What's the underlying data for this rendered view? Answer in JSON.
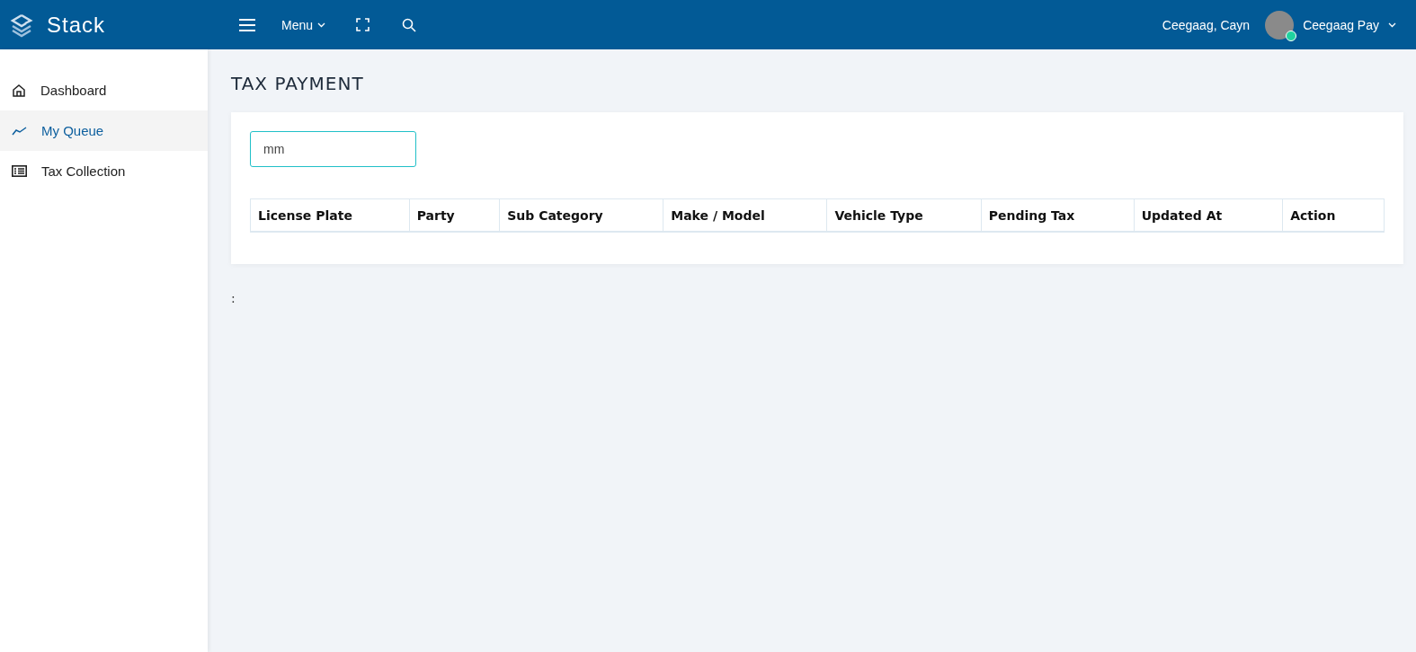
{
  "topbar": {
    "brand": "Stack",
    "menu_label": "Menu",
    "user_name": "Ceegaag, Cayn",
    "account": "Ceegaag Pay",
    "online": true
  },
  "sidebar": {
    "items": [
      {
        "label": "Dashboard",
        "kind": "home",
        "selected": false
      },
      {
        "label": "My Queue",
        "kind": "chart",
        "selected": true
      },
      {
        "label": "Tax Collection",
        "kind": "list",
        "selected": false
      }
    ]
  },
  "page": {
    "title": "TAX PAYMENT",
    "search": {
      "value": "mm"
    },
    "table": {
      "columns": [
        "License Plate",
        "Party",
        "Sub Category",
        "Make / Model",
        "Vehicle Type",
        "Pending Tax",
        "Updated At",
        "Action"
      ]
    },
    "footer_text": ":"
  }
}
